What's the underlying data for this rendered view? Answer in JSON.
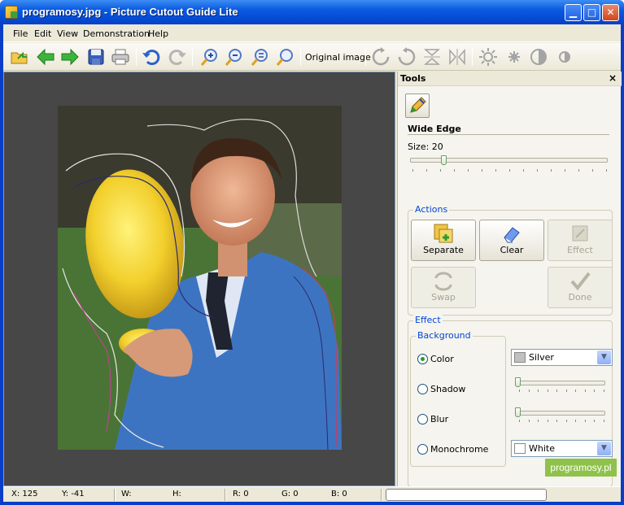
{
  "window": {
    "title": "programosy.jpg - Picture Cutout Guide Lite"
  },
  "menu": [
    "File",
    "Edit",
    "View",
    "Demonstration",
    "Help"
  ],
  "toolbar": {
    "original_image_label": "Original image",
    "icons": [
      "open-folder-icon",
      "back-arrow-icon",
      "forward-arrow-icon",
      "save-disk-icon",
      "print-icon",
      "undo-icon",
      "redo-icon",
      "zoom-in-icon",
      "zoom-out-icon",
      "zoom-fit-icon",
      "zoom-actual-icon",
      "rotate-right-icon",
      "rotate-left-icon",
      "flip-vertical-icon",
      "flip-horizontal-icon",
      "brightness-up-icon",
      "brightness-down-icon",
      "contrast-up-icon",
      "contrast-down-icon"
    ]
  },
  "tools_panel": {
    "title": "Tools",
    "close": "×",
    "tool_name": "Wide Edge",
    "size_label": "Size: 20",
    "size_value": 20,
    "actions": {
      "label": "Actions",
      "buttons": [
        {
          "label": "Separate",
          "enabled": true
        },
        {
          "label": "Clear",
          "enabled": true
        },
        {
          "label": "Effect",
          "enabled": false
        },
        {
          "label": "Swap",
          "enabled": false
        },
        {
          "label": "Done",
          "enabled": false
        }
      ]
    },
    "effect": {
      "label": "Effect",
      "background_label": "Background",
      "options": [
        {
          "label": "Color",
          "checked": true
        },
        {
          "label": "Shadow",
          "checked": false
        },
        {
          "label": "Blur",
          "checked": false
        },
        {
          "label": "Monochrome",
          "checked": false
        }
      ],
      "color_value": "Silver",
      "color_swatch": "#c0c0c0",
      "mono_value": "White",
      "mono_swatch": "#ffffff"
    }
  },
  "status": {
    "x": "X: 125",
    "y": "Y: -41",
    "w": "W:",
    "h": "H:",
    "r": "R: 0",
    "g": "G: 0",
    "b": "B: 0"
  },
  "brand": "programosy.pl"
}
